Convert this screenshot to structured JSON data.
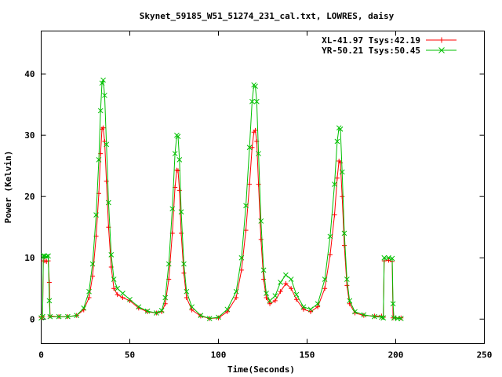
{
  "chart_data": {
    "type": "line",
    "title": "Skynet_59185_W51_51274_231_cal.txt, LOWRES, daisy",
    "xlabel": "Time(Seconds)",
    "ylabel": "Power (Kelvin)",
    "xlim": [
      0,
      250
    ],
    "ylim": [
      -4,
      47
    ],
    "xticks": [
      0,
      50,
      100,
      150,
      200,
      250
    ],
    "yticks": [
      0,
      10,
      20,
      30,
      40
    ],
    "xtick_labels": [
      "0",
      "50",
      "100",
      "150",
      "200",
      "250"
    ],
    "ytick_labels": [
      "0",
      "10",
      "20",
      "30",
      "40"
    ],
    "grid": false,
    "legend_position": "top-right",
    "series": [
      {
        "name": "XL-41.97 Tsys:42.19",
        "color": "#ff0000",
        "marker": "plus",
        "values": [
          [
            0,
            0.3
          ],
          [
            0.8,
            0.4
          ],
          [
            1.2,
            9.5
          ],
          [
            2,
            9.5
          ],
          [
            3,
            9.4
          ],
          [
            4,
            9.5
          ],
          [
            4.6,
            6
          ],
          [
            5,
            0.5
          ],
          [
            10,
            0.4
          ],
          [
            15,
            0.4
          ],
          [
            20,
            0.6
          ],
          [
            24,
            1.5
          ],
          [
            27,
            3.5
          ],
          [
            29,
            7
          ],
          [
            31,
            13.5
          ],
          [
            32.5,
            20.5
          ],
          [
            33.5,
            27
          ],
          [
            34.3,
            31
          ],
          [
            35,
            31.2
          ],
          [
            35.8,
            29
          ],
          [
            36.8,
            22.5
          ],
          [
            38,
            15
          ],
          [
            39.5,
            8.5
          ],
          [
            41,
            5
          ],
          [
            43,
            4
          ],
          [
            46,
            3.5
          ],
          [
            50,
            3
          ],
          [
            55,
            1.8
          ],
          [
            60,
            1.2
          ],
          [
            65,
            1
          ],
          [
            68,
            1.2
          ],
          [
            70,
            2.5
          ],
          [
            72,
            6.5
          ],
          [
            74,
            14
          ],
          [
            75.5,
            21.5
          ],
          [
            76.5,
            24.3
          ],
          [
            77.2,
            24.2
          ],
          [
            78,
            21
          ],
          [
            79,
            14
          ],
          [
            80.5,
            7.5
          ],
          [
            82,
            3.5
          ],
          [
            85,
            1.5
          ],
          [
            90,
            0.5
          ],
          [
            95,
            0.1
          ],
          [
            100,
            0.2
          ],
          [
            105,
            1.2
          ],
          [
            110,
            3.5
          ],
          [
            113,
            8
          ],
          [
            115.5,
            14.5
          ],
          [
            117.5,
            22
          ],
          [
            119,
            28
          ],
          [
            120,
            30.5
          ],
          [
            120.8,
            30.8
          ],
          [
            121.6,
            29
          ],
          [
            122.6,
            22
          ],
          [
            124,
            13
          ],
          [
            125.5,
            6.5
          ],
          [
            127,
            3.5
          ],
          [
            129,
            2.5
          ],
          [
            132,
            3
          ],
          [
            135,
            4.5
          ],
          [
            138,
            5.8
          ],
          [
            141,
            5
          ],
          [
            144,
            3.2
          ],
          [
            148,
            1.6
          ],
          [
            152,
            1.2
          ],
          [
            156,
            2
          ],
          [
            160,
            5
          ],
          [
            163,
            10.5
          ],
          [
            165.5,
            17
          ],
          [
            167,
            23
          ],
          [
            168,
            25.8
          ],
          [
            168.8,
            25.5
          ],
          [
            169.8,
            20
          ],
          [
            171,
            12
          ],
          [
            172.5,
            5.5
          ],
          [
            174,
            2.5
          ],
          [
            177,
            1
          ],
          [
            182,
            0.6
          ],
          [
            188,
            0.5
          ],
          [
            192,
            0.5
          ],
          [
            193,
            0.3
          ],
          [
            193.5,
            9.5
          ],
          [
            196,
            9.6
          ],
          [
            198,
            9.4
          ],
          [
            198.5,
            0.2
          ],
          [
            200,
            0.2
          ],
          [
            203,
            0.2
          ]
        ]
      },
      {
        "name": "YR-50.21 Tsys:50.45",
        "color": "#00c000",
        "marker": "cross",
        "values": [
          [
            0,
            0.2
          ],
          [
            0.8,
            0.4
          ],
          [
            1.2,
            10.3
          ],
          [
            2,
            10.3
          ],
          [
            3,
            10.2
          ],
          [
            4,
            10.3
          ],
          [
            4.6,
            3
          ],
          [
            5,
            0.4
          ],
          [
            10,
            0.4
          ],
          [
            15,
            0.4
          ],
          [
            20,
            0.6
          ],
          [
            24,
            1.8
          ],
          [
            27,
            4.5
          ],
          [
            29,
            9
          ],
          [
            31,
            17
          ],
          [
            32.5,
            26
          ],
          [
            33.5,
            34
          ],
          [
            34.3,
            38.5
          ],
          [
            35,
            39
          ],
          [
            35.8,
            36.5
          ],
          [
            36.8,
            28.5
          ],
          [
            38,
            19
          ],
          [
            39.5,
            10.5
          ],
          [
            41,
            6.5
          ],
          [
            43,
            5
          ],
          [
            46,
            4.2
          ],
          [
            50,
            3.2
          ],
          [
            55,
            2
          ],
          [
            60,
            1.3
          ],
          [
            65,
            1
          ],
          [
            68,
            1.4
          ],
          [
            70,
            3.5
          ],
          [
            72,
            9
          ],
          [
            74,
            18
          ],
          [
            75.5,
            27
          ],
          [
            76.5,
            30
          ],
          [
            77.2,
            29.8
          ],
          [
            78,
            26
          ],
          [
            79,
            17.5
          ],
          [
            80.5,
            9
          ],
          [
            82,
            4.5
          ],
          [
            85,
            2
          ],
          [
            90,
            0.6
          ],
          [
            95,
            0.1
          ],
          [
            100,
            0.3
          ],
          [
            105,
            1.6
          ],
          [
            110,
            4.5
          ],
          [
            113,
            10
          ],
          [
            115.5,
            18.5
          ],
          [
            117.5,
            28
          ],
          [
            119,
            35.5
          ],
          [
            120,
            38.2
          ],
          [
            120.8,
            38
          ],
          [
            121.6,
            35.5
          ],
          [
            122.6,
            27
          ],
          [
            124,
            16
          ],
          [
            125.5,
            8
          ],
          [
            127,
            4.2
          ],
          [
            129,
            3
          ],
          [
            132,
            3.8
          ],
          [
            135,
            6
          ],
          [
            138,
            7.2
          ],
          [
            141,
            6.5
          ],
          [
            144,
            4
          ],
          [
            148,
            2
          ],
          [
            152,
            1.6
          ],
          [
            156,
            2.5
          ],
          [
            160,
            6.5
          ],
          [
            163,
            13.5
          ],
          [
            165.5,
            22
          ],
          [
            167,
            29
          ],
          [
            168,
            31.2
          ],
          [
            168.8,
            31
          ],
          [
            169.8,
            24
          ],
          [
            171,
            14
          ],
          [
            172.5,
            6.5
          ],
          [
            174,
            3
          ],
          [
            177,
            1.2
          ],
          [
            182,
            0.7
          ],
          [
            188,
            0.4
          ],
          [
            192,
            0.3
          ],
          [
            193,
            0.2
          ],
          [
            193.5,
            10
          ],
          [
            196,
            10
          ],
          [
            198,
            9.9
          ],
          [
            198.5,
            2.5
          ],
          [
            199,
            0.2
          ],
          [
            201,
            0.1
          ],
          [
            203,
            0.1
          ]
        ]
      }
    ]
  }
}
